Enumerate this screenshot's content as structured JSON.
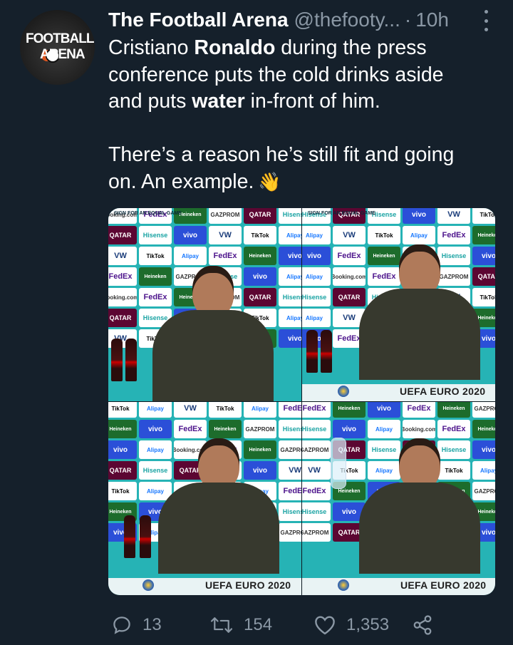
{
  "tweet": {
    "author_name": "The Football Arena",
    "author_handle": "@thefooty...",
    "separator": "·",
    "time": "10h",
    "avatar_text_top": "FOOTBALL",
    "avatar_text_bottom": "ARENA",
    "text_line1_pre": "Cristiano ",
    "text_line1_bold": "Ronaldo",
    "text_line1_post": " during the press conference puts the cold drinks aside and puts ",
    "text_line1_bold2": "water",
    "text_line1_post2": " in-front of him.",
    "text_line2": "There’s a reason he’s still fit and going on. An example.",
    "emoji": "👋"
  },
  "media": {
    "panels": [
      {
        "banner": "SIGN FOR AN EQUAL GAME"
      },
      {
        "banner": "SIGN FOR AN EQUAL GAME",
        "caption": "UEFA EURO 2020"
      },
      {
        "caption": "UEFA EURO 2020"
      },
      {
        "caption": "UEFA EURO 2020"
      }
    ],
    "sponsors": [
      "Booking.com",
      "FedEx",
      "Heineken",
      "GAZPROM",
      "QATAR",
      "Hisense",
      "QATAR",
      "Hisense",
      "vivo",
      "VW",
      "TikTok",
      "Alipay",
      "VW",
      "TikTok",
      "Alipay",
      "FedEx",
      "Heineken",
      "vivo",
      "FedEx",
      "Heineken",
      "GAZPROM",
      "Hisense",
      "vivo",
      "Alipay"
    ]
  },
  "actions": {
    "reply_count": "13",
    "retweet_count": "154",
    "like_count": "1,353"
  }
}
